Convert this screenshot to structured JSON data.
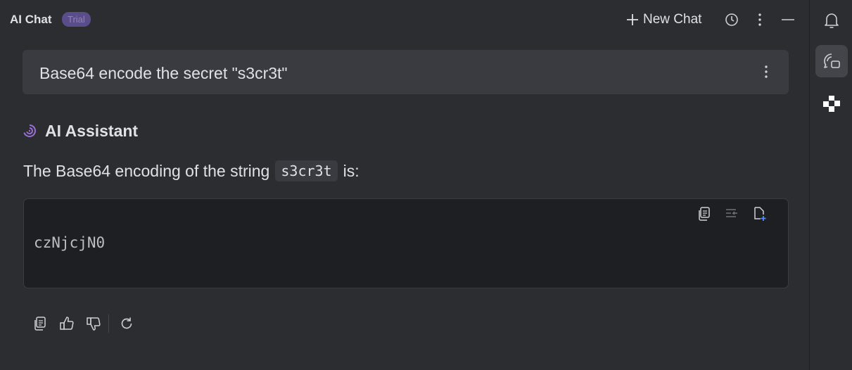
{
  "header": {
    "title": "AI Chat",
    "badge": "Trial",
    "new_chat_label": "New Chat",
    "icons": [
      "plus-icon",
      "history-icon",
      "more-vertical-icon",
      "minimize-icon"
    ]
  },
  "user_message": {
    "text": "Base64 encode the secret \"s3cr3t\""
  },
  "assistant": {
    "name": "AI Assistant",
    "answer_prefix": "The Base64 encoding of the string",
    "answer_code": "s3cr3t",
    "answer_suffix": "is:",
    "code_block": "czNjcjN0",
    "code_icons": [
      "copy-icon",
      "insert-at-caret-icon",
      "new-file-icon"
    ],
    "action_icons": [
      "copy-icon",
      "thumbs-up-icon",
      "thumbs-down-icon",
      "regenerate-icon"
    ]
  },
  "right_toolbar": {
    "icons": [
      "notifications-icon",
      "ai-chat-icon",
      "plugin-icon"
    ],
    "active": "ai-chat-icon"
  },
  "colors": {
    "background": "#2b2d30",
    "bubble": "#393b40",
    "code_background": "#1e1f22",
    "badge_bg": "#5b4d89",
    "badge_text": "#8f84b8",
    "assistant_logo": "#9b6fd6"
  }
}
